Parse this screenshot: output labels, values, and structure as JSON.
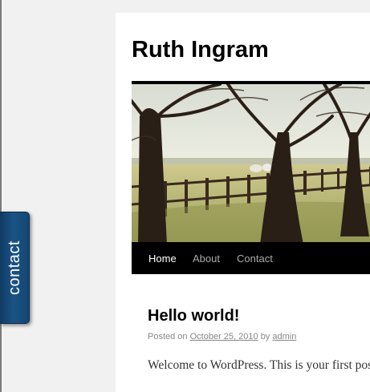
{
  "site": {
    "title": "Ruth Ingram"
  },
  "contact_tab": {
    "label": "contact"
  },
  "header_image": {
    "icon": "header-photo-trees-fence-sheep"
  },
  "nav": {
    "items": [
      {
        "label": "Home",
        "current": true
      },
      {
        "label": "About",
        "current": false
      },
      {
        "label": "Contact",
        "current": false
      }
    ]
  },
  "post": {
    "title": "Hello world!",
    "meta_prefix": "Posted on",
    "date": "October 25, 2010",
    "meta_by": "by",
    "author": "admin",
    "content": "Welcome to WordPress. This is your first post."
  },
  "colors": {
    "page_background": "#f1f1f1",
    "content_background": "#ffffff",
    "nav_background": "#000000",
    "nav_current": "#ffffff",
    "nav_link": "#aaaaaa",
    "contact_tab": "#1a5385",
    "meta_text": "#888888"
  }
}
